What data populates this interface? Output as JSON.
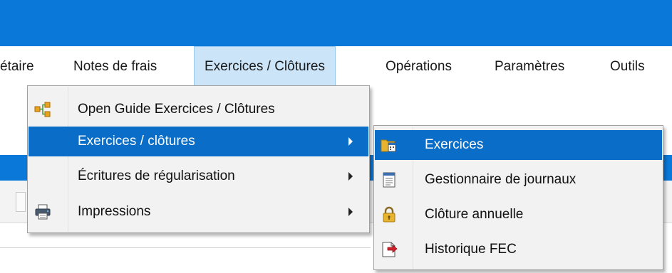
{
  "menubar": {
    "items": [
      {
        "label": "étaire",
        "active": false
      },
      {
        "label": "Notes de frais",
        "active": false
      },
      {
        "label": "Exercices / Clôtures",
        "active": true
      },
      {
        "label": "Opérations",
        "active": false
      },
      {
        "label": "Paramètres",
        "active": false
      },
      {
        "label": "Outils",
        "active": false
      }
    ]
  },
  "dropdown": {
    "items": [
      {
        "label": "Open Guide Exercices / Clôtures",
        "icon": "flowchart-icon",
        "submenu": false,
        "highlighted": false
      },
      {
        "label": "Exercices / clôtures",
        "icon": "",
        "submenu": true,
        "highlighted": true
      },
      {
        "label": "Écritures de régularisation",
        "icon": "",
        "submenu": true,
        "highlighted": false
      },
      {
        "label": "Impressions",
        "icon": "printer-icon",
        "submenu": true,
        "highlighted": false
      }
    ]
  },
  "submenu": {
    "items": [
      {
        "label": "Exercices",
        "icon": "folder-calendar-icon",
        "highlighted": true
      },
      {
        "label": "Gestionnaire de journaux",
        "icon": "journal-document-icon",
        "highlighted": false
      },
      {
        "label": "Clôture annuelle",
        "icon": "padlock-icon",
        "highlighted": false
      },
      {
        "label": "Historique FEC",
        "icon": "document-export-icon",
        "highlighted": false
      }
    ]
  },
  "colors": {
    "titlebar": "#0a78d8",
    "highlight": "#0a6dc7",
    "active_menu": "#cce4f7",
    "menu_bg": "#f2f2f2"
  }
}
